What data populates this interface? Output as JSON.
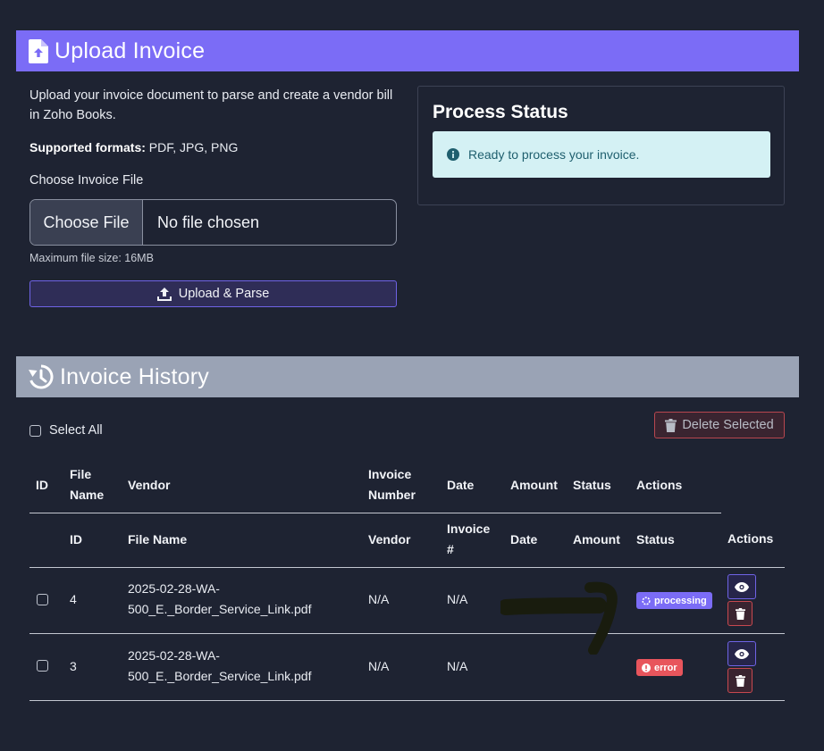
{
  "upload": {
    "title": "Upload Invoice",
    "description": "Upload your invoice document to parse and create a vendor bill in Zoho Books.",
    "formats_label": "Supported formats:",
    "formats_value": "PDF, JPG, PNG",
    "choose_label": "Choose Invoice File",
    "file_button": "Choose File",
    "file_name": "No file chosen",
    "max_size": "Maximum file size: 16MB",
    "submit_label": "Upload & Parse"
  },
  "status": {
    "title": "Process Status",
    "message": "Ready to process your invoice."
  },
  "history": {
    "title": "Invoice History",
    "select_all": "Select All",
    "delete_selected": "Delete Selected",
    "header1": [
      "ID",
      "File Name",
      "Vendor",
      "Invoice Number",
      "Date",
      "Amount",
      "Status",
      "Actions"
    ],
    "header2": [
      "ID",
      "File Name",
      "Vendor",
      "Invoice #",
      "Date",
      "Amount",
      "Status",
      "Actions"
    ],
    "rows": [
      {
        "id": "4",
        "file_name": "2025-02-28-WA-500_E._Border_Service_Link.pdf",
        "vendor": "N/A",
        "invoice": "N/A",
        "date": "",
        "amount": "",
        "status": "processing"
      },
      {
        "id": "3",
        "file_name": "2025-02-28-WA-500_E._Border_Service_Link.pdf",
        "vendor": "N/A",
        "invoice": "N/A",
        "date": "",
        "amount": "",
        "status": "error"
      }
    ]
  },
  "colors": {
    "accent": "#7b6cf6",
    "history_header": "#9aa3b5",
    "background": "#1e2332",
    "error": "#e8555c",
    "info_bg": "#d4f1f4"
  },
  "icons": [
    "file-upload-icon",
    "upload-icon",
    "info-icon",
    "history-icon",
    "trash-icon",
    "eye-icon",
    "spinner-icon",
    "exclamation-icon"
  ]
}
